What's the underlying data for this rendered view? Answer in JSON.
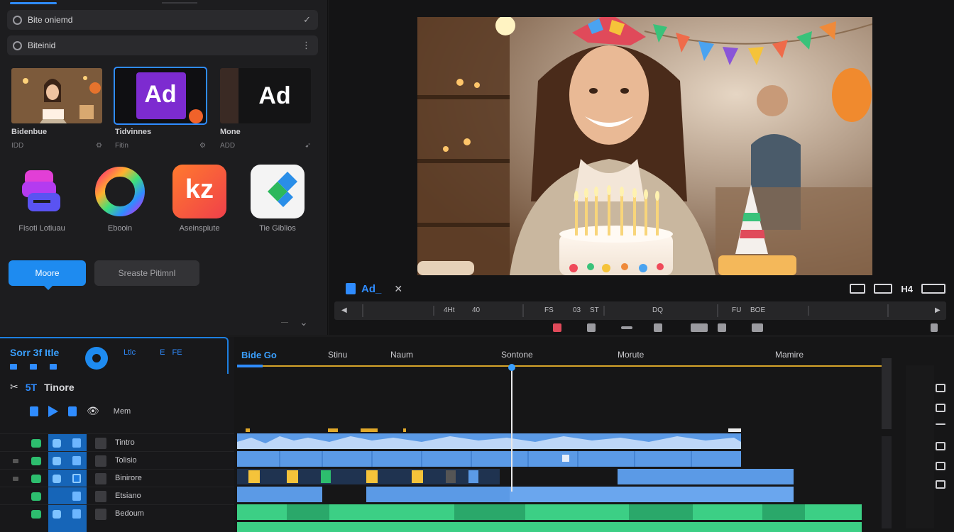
{
  "left_panel": {
    "search1": {
      "text": "Bite oniemd",
      "end_icon": "checkmark-icon"
    },
    "search2": {
      "text": "Biteinid",
      "end_icon": "more-icon"
    },
    "thumbnails": [
      {
        "title": "Bidenbue",
        "meta": "IDD"
      },
      {
        "title": "Tidvinnes",
        "meta": "Fitin",
        "thumb_text": "Ad",
        "selected": true
      },
      {
        "title": "Mone",
        "meta": "ADD",
        "thumb_text": "Ad"
      }
    ],
    "apps": [
      {
        "label": "Fisoti Lotiuau"
      },
      {
        "label": "Ebooin"
      },
      {
        "label": "Aseinspiute",
        "icon_text": "kz"
      },
      {
        "label": "Tie Giblios"
      }
    ],
    "primary_button": "Moore",
    "secondary_button": "Sreaste Pitimnl"
  },
  "preview": {
    "toolbar_label": "Ad_",
    "scrub_labels": [
      "4Ht",
      "40",
      "FS",
      "03",
      "ST",
      "DQ",
      "FU",
      "BOE"
    ],
    "right_text": "H4"
  },
  "timeline": {
    "title": "Sorr 3f Itle",
    "head_meta": [
      "Ltlc",
      "E",
      "FE"
    ],
    "section_num": "5T",
    "section_label": "Tinore",
    "control_label": "Mem",
    "ruler": [
      {
        "label": "Bide Go"
      },
      {
        "label": "Stinu"
      },
      {
        "label": "Naum"
      },
      {
        "label": "Sontone"
      },
      {
        "label": "Morute"
      },
      {
        "label": "Mamire"
      }
    ],
    "tracks": [
      {
        "name": "Tintro"
      },
      {
        "name": "Tolisio"
      },
      {
        "name": "Binirore"
      },
      {
        "name": "Etsiano"
      },
      {
        "name": "Bedoum"
      }
    ]
  },
  "colors": {
    "accent": "#2f8cff",
    "audio_clip": "#5b9ae6",
    "green_clip": "#3ccf85",
    "marker": "#e0a82a"
  }
}
